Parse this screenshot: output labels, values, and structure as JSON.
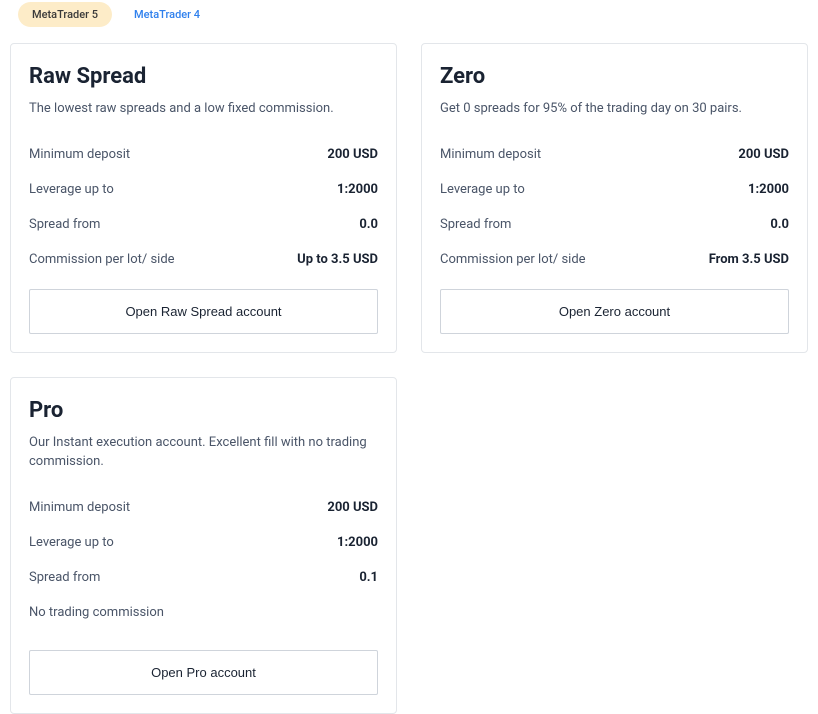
{
  "tabs": {
    "mt5": "MetaTrader 5",
    "mt4": "MetaTrader 4"
  },
  "accounts": {
    "rawspread": {
      "title": "Raw Spread",
      "desc": "The lowest raw spreads and a low fixed commission.",
      "rows": [
        {
          "label": "Minimum deposit",
          "value": "200 USD"
        },
        {
          "label": "Leverage up to",
          "value": "1:2000"
        },
        {
          "label": "Spread from",
          "value": "0.0"
        },
        {
          "label": "Commission per lot/ side",
          "value": "Up to 3.5 USD"
        }
      ],
      "cta": "Open Raw Spread account"
    },
    "zero": {
      "title": "Zero",
      "desc": "Get 0 spreads for 95% of the trading day on 30 pairs.",
      "rows": [
        {
          "label": "Minimum deposit",
          "value": "200 USD"
        },
        {
          "label": "Leverage up to",
          "value": "1:2000"
        },
        {
          "label": "Spread from",
          "value": "0.0"
        },
        {
          "label": "Commission per lot/ side",
          "value": "From 3.5 USD"
        }
      ],
      "cta": "Open Zero account"
    },
    "pro": {
      "title": "Pro",
      "desc": "Our Instant execution account. Excellent fill with no trading commission.",
      "rows": [
        {
          "label": "Minimum deposit",
          "value": "200 USD"
        },
        {
          "label": "Leverage up to",
          "value": "1:2000"
        },
        {
          "label": "Spread from",
          "value": "0.1"
        }
      ],
      "note": "No trading commission",
      "cta": "Open Pro account"
    }
  }
}
